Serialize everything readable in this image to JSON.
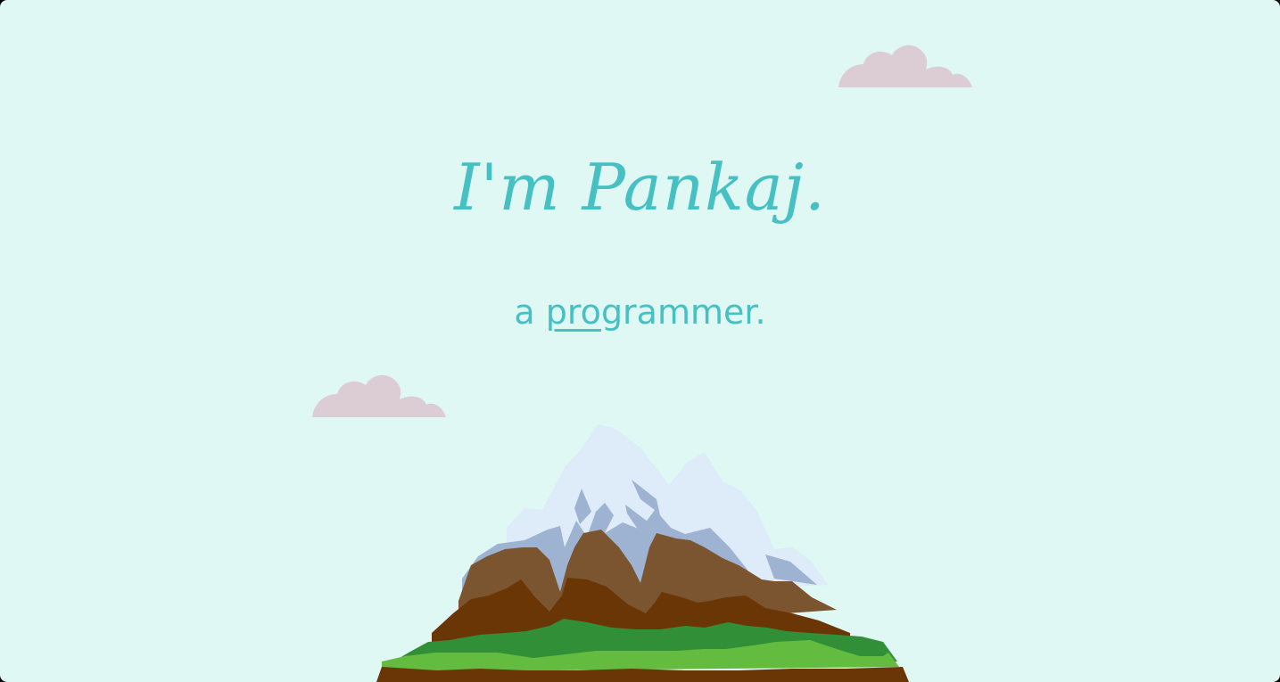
{
  "hero": {
    "title": "I'm Pankaj.",
    "subtitle_prefix": "a ",
    "subtitle_typed": "pro",
    "subtitle_rest": "grammer."
  },
  "colors": {
    "background": "#DFF8F3",
    "accent": "#47C0C4",
    "cloud": "#DCCCD3",
    "snow": "#DEEBF9",
    "snow_shadow": "#9EB3D1",
    "rock_light": "#7A5530",
    "rock_dark": "#6A3605",
    "grass_dark": "#318F38",
    "grass_light": "#63BB3F",
    "soil": "#6A3605"
  },
  "icons": {
    "clouds": "cloud-icon",
    "illustration": "mountain-illustration"
  }
}
